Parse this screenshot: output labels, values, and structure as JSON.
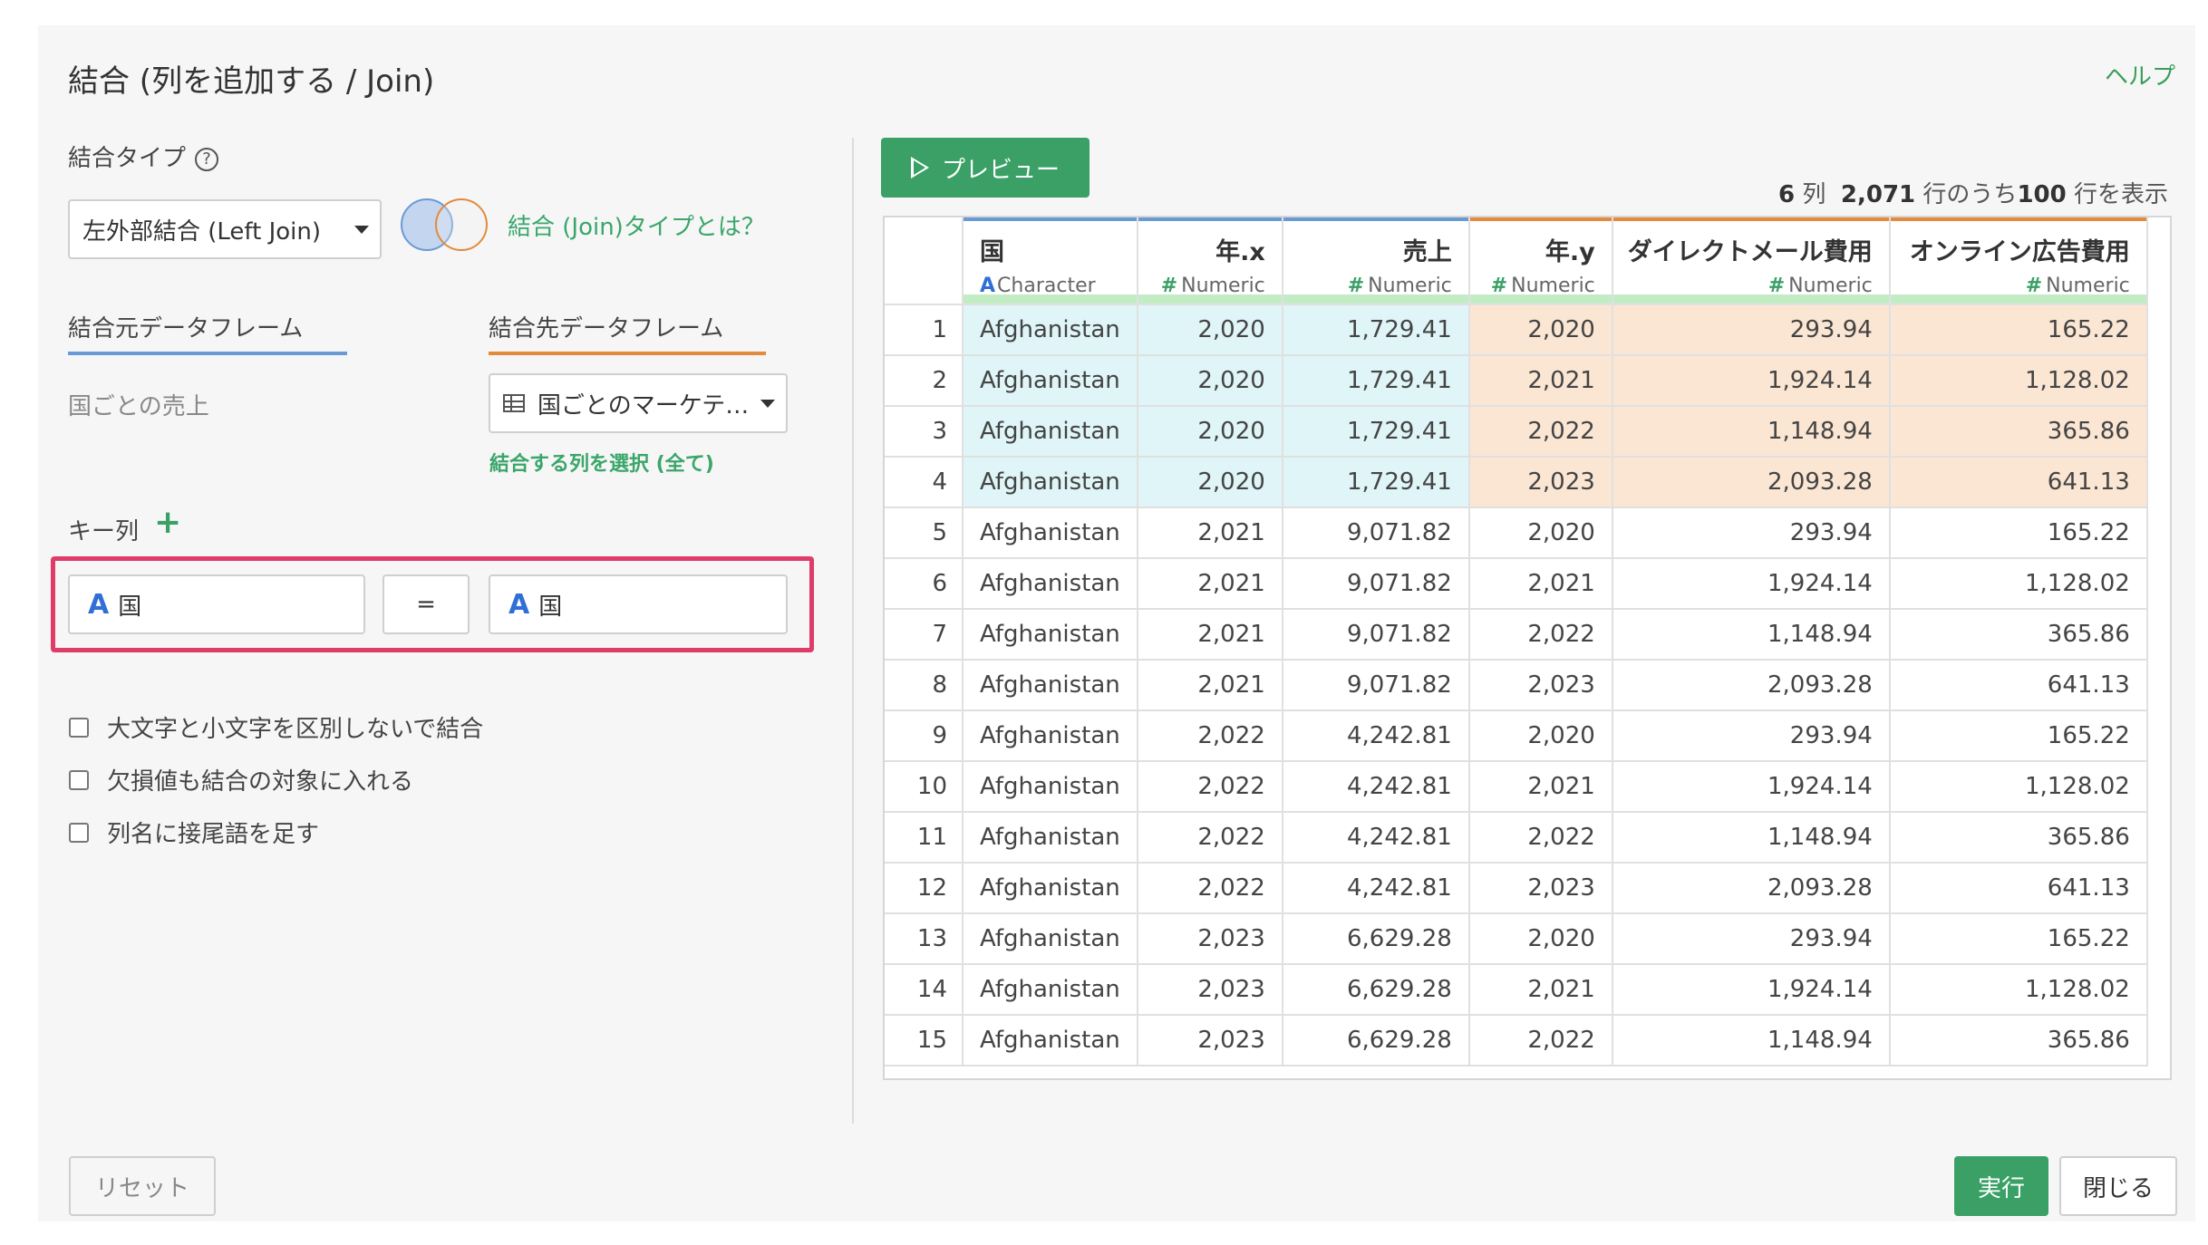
{
  "dialog": {
    "title": "結合 (列を追加する / Join)",
    "help": "ヘルプ"
  },
  "left": {
    "join_type_label": "結合タイプ",
    "join_type_value": "左外部結合 (Left Join)",
    "join_type_link": "結合 (Join)タイプとは？",
    "source_label": "結合元データフレーム",
    "source_value": "国ごとの売上",
    "target_label": "結合先データフレーム",
    "target_value": "国ごとのマーケテ…",
    "select_columns_link": "結合する列を選択 (全て)",
    "key_label": "キー列",
    "key_left": "国",
    "key_equals": "=",
    "key_right": "国",
    "type_icon_char": "A",
    "checkbox_case": "大文字と小文字を区別しないで結合",
    "checkbox_missing": "欠損値も結合の対象に入れる",
    "checkbox_suffix": "列名に接尾語を足す"
  },
  "preview": {
    "button": "プレビュー",
    "cols": "6",
    "cols_unit": "列",
    "total_rows": "2,071",
    "rows_mid": "行のうち",
    "shown_rows": "100",
    "rows_end": "行を表示"
  },
  "table": {
    "columns": [
      {
        "name": "国",
        "type": "Character",
        "type_icon": "A"
      },
      {
        "name": "年.x",
        "type": "Numeric",
        "type_icon": "#"
      },
      {
        "name": "売上",
        "type": "Numeric",
        "type_icon": "#"
      },
      {
        "name": "年.y",
        "type": "Numeric",
        "type_icon": "#"
      },
      {
        "name": "ダイレクトメール費用",
        "type": "Numeric",
        "type_icon": "#"
      },
      {
        "name": "オンライン広告費用",
        "type": "Numeric",
        "type_icon": "#"
      }
    ],
    "rows": [
      [
        "1",
        "Afghanistan",
        "2,020",
        "1,729.41",
        "2,020",
        "293.94",
        "165.22"
      ],
      [
        "2",
        "Afghanistan",
        "2,020",
        "1,729.41",
        "2,021",
        "1,924.14",
        "1,128.02"
      ],
      [
        "3",
        "Afghanistan",
        "2,020",
        "1,729.41",
        "2,022",
        "1,148.94",
        "365.86"
      ],
      [
        "4",
        "Afghanistan",
        "2,020",
        "1,729.41",
        "2,023",
        "2,093.28",
        "641.13"
      ],
      [
        "5",
        "Afghanistan",
        "2,021",
        "9,071.82",
        "2,020",
        "293.94",
        "165.22"
      ],
      [
        "6",
        "Afghanistan",
        "2,021",
        "9,071.82",
        "2,021",
        "1,924.14",
        "1,128.02"
      ],
      [
        "7",
        "Afghanistan",
        "2,021",
        "9,071.82",
        "2,022",
        "1,148.94",
        "365.86"
      ],
      [
        "8",
        "Afghanistan",
        "2,021",
        "9,071.82",
        "2,023",
        "2,093.28",
        "641.13"
      ],
      [
        "9",
        "Afghanistan",
        "2,022",
        "4,242.81",
        "2,020",
        "293.94",
        "165.22"
      ],
      [
        "10",
        "Afghanistan",
        "2,022",
        "4,242.81",
        "2,021",
        "1,924.14",
        "1,128.02"
      ],
      [
        "11",
        "Afghanistan",
        "2,022",
        "4,242.81",
        "2,022",
        "1,148.94",
        "365.86"
      ],
      [
        "12",
        "Afghanistan",
        "2,022",
        "4,242.81",
        "2,023",
        "2,093.28",
        "641.13"
      ],
      [
        "13",
        "Afghanistan",
        "2,023",
        "6,629.28",
        "2,020",
        "293.94",
        "165.22"
      ],
      [
        "14",
        "Afghanistan",
        "2,023",
        "6,629.28",
        "2,021",
        "1,924.14",
        "1,128.02"
      ],
      [
        "15",
        "Afghanistan",
        "2,023",
        "6,629.28",
        "2,022",
        "1,148.94",
        "365.86"
      ]
    ],
    "highlighted_rows": 4
  },
  "footer": {
    "reset": "リセット",
    "run": "実行",
    "close": "閉じる"
  },
  "colors": {
    "accent_green": "#3aa066",
    "source_blue": "#6a9ad6",
    "target_orange": "#e38a3c",
    "key_highlight": "#e03c6a",
    "source_cell_bg": "#dff5f7",
    "target_cell_bg": "#fbe6d3"
  }
}
